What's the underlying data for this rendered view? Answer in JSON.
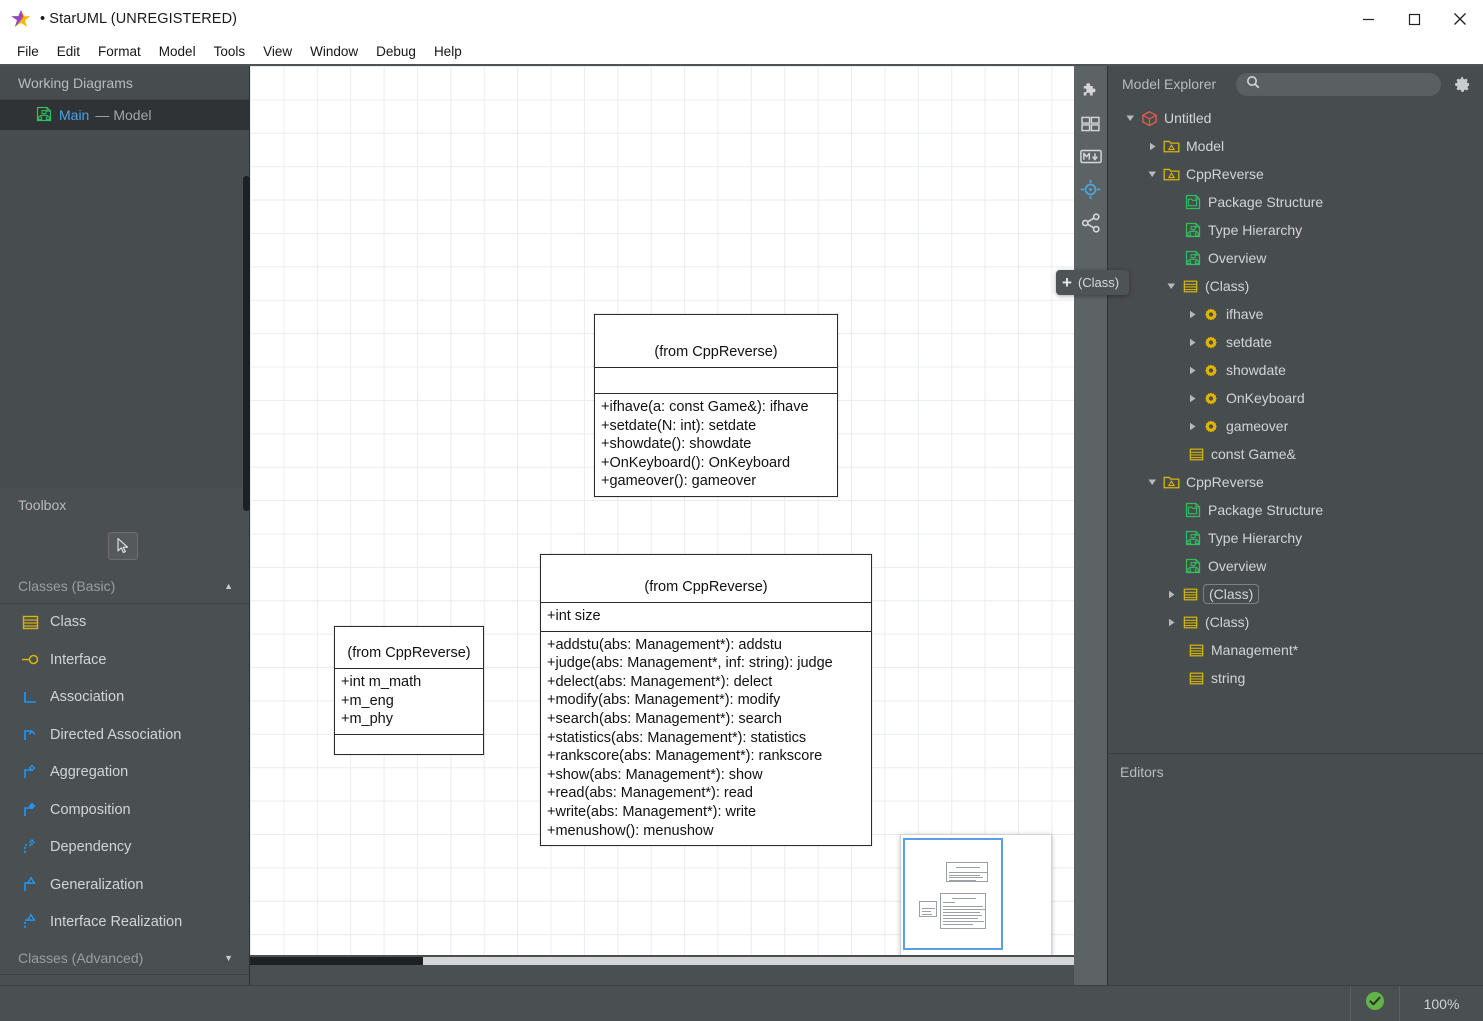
{
  "window": {
    "title": "• StarUML (UNREGISTERED)",
    "app_icon": "star-icon",
    "minimize_label": "—",
    "maximize_label": "▢",
    "close_label": "✕"
  },
  "menubar": {
    "items": [
      {
        "label": "File"
      },
      {
        "label": "Edit"
      },
      {
        "label": "Format"
      },
      {
        "label": "Model"
      },
      {
        "label": "Tools"
      },
      {
        "label": "View"
      },
      {
        "label": "Window"
      },
      {
        "label": "Debug"
      },
      {
        "label": "Help"
      }
    ]
  },
  "sidebar": {
    "working_diagrams": {
      "header": "Working Diagrams",
      "items": [
        {
          "name": "Main",
          "separator": "—",
          "type": "Model",
          "icon": "diagram-icon",
          "selected": true
        }
      ]
    },
    "toolbox": {
      "header": "Toolbox",
      "pointer_icon": "cursor-arrow-icon",
      "groups": [
        {
          "label": "Classes (Basic)",
          "caret": "▲",
          "expanded": true,
          "items": [
            {
              "label": "Class",
              "icon": "class-icon"
            },
            {
              "label": "Interface",
              "icon": "interface-icon"
            },
            {
              "label": "Association",
              "icon": "association-icon"
            },
            {
              "label": "Directed Association",
              "icon": "directed-association-icon"
            },
            {
              "label": "Aggregation",
              "icon": "aggregation-icon"
            },
            {
              "label": "Composition",
              "icon": "composition-icon"
            },
            {
              "label": "Dependency",
              "icon": "dependency-icon"
            },
            {
              "label": "Generalization",
              "icon": "generalization-icon"
            },
            {
              "label": "Interface Realization",
              "icon": "interface-realization-icon"
            }
          ]
        },
        {
          "label": "Classes (Advanced)",
          "caret": "▼",
          "expanded": false,
          "items": []
        }
      ]
    }
  },
  "canvas": {
    "tooltip": {
      "plus": "+",
      "label": "(Class)"
    },
    "rail_icons": [
      {
        "name": "extension-puzzle-icon"
      },
      {
        "name": "panels-grid-icon"
      },
      {
        "name": "markdown-icon"
      },
      {
        "name": "target-crosshair-icon",
        "active": true
      },
      {
        "name": "share-network-icon"
      }
    ],
    "classes": [
      {
        "id": "game-class",
        "from": "(from CppReverse)",
        "attributes": [],
        "operations": [
          "+ifhave(a: const Game&): ifhave",
          "+setdate(N: int): setdate",
          "+showdate(): showdate",
          "+OnKeyboard(): OnKeyboard",
          "+gameover(): gameover"
        ]
      },
      {
        "id": "management-class",
        "from": "(from CppReverse)",
        "attributes": [
          "+int size"
        ],
        "operations": [
          "+addstu(abs: Management*): addstu",
          "+judge(abs: Management*, inf: string): judge",
          "+delect(abs: Management*): delect",
          "+modify(abs: Management*): modify",
          "+search(abs: Management*): search",
          "+statistics(abs: Management*): statistics",
          "+rankscore(abs: Management*): rankscore",
          "+show(abs: Management*): show",
          "+read(abs: Management*): read",
          "+write(abs: Management*): write",
          "+menushow(): menushow"
        ]
      },
      {
        "id": "student-class",
        "from": "(from CppReverse)",
        "attributes": [
          "+int m_math",
          "+m_eng",
          "+m_phy"
        ],
        "operations": []
      }
    ]
  },
  "model_explorer": {
    "title": "Model Explorer",
    "search_placeholder": "",
    "search_value": "",
    "search_icon": "search-icon",
    "gear_icon": "gear-icon",
    "tree": [
      {
        "label": "Untitled",
        "depth": 0,
        "arrow": "down",
        "icon": "project-icon"
      },
      {
        "label": "Model",
        "depth": 1,
        "arrow": "right",
        "icon": "folder-model-icon"
      },
      {
        "label": "CppReverse",
        "depth": 1,
        "arrow": "down",
        "icon": "folder-model-icon"
      },
      {
        "label": "Package Structure",
        "depth": 2,
        "arrow": "none",
        "icon": "package-diagram-icon"
      },
      {
        "label": "Type Hierarchy",
        "depth": 2,
        "arrow": "none",
        "icon": "class-diagram-icon"
      },
      {
        "label": "Overview",
        "depth": 2,
        "arrow": "none",
        "icon": "class-diagram-icon"
      },
      {
        "label": "(Class)",
        "depth": 2,
        "arrow": "down",
        "icon": "class-icon"
      },
      {
        "label": "ifhave",
        "depth": 3,
        "arrow": "right",
        "icon": "operation-icon"
      },
      {
        "label": "setdate",
        "depth": 3,
        "arrow": "right",
        "icon": "operation-icon"
      },
      {
        "label": "showdate",
        "depth": 3,
        "arrow": "right",
        "icon": "operation-icon"
      },
      {
        "label": "OnKeyboard",
        "depth": 3,
        "arrow": "right",
        "icon": "operation-icon"
      },
      {
        "label": "gameover",
        "depth": 3,
        "arrow": "right",
        "icon": "operation-icon"
      },
      {
        "label": "const Game&",
        "depth": 3,
        "arrow": "none",
        "icon": "class-icon"
      },
      {
        "label": "CppReverse",
        "depth": 1,
        "arrow": "down",
        "icon": "folder-model-icon"
      },
      {
        "label": "Package Structure",
        "depth": 2,
        "arrow": "none",
        "icon": "package-diagram-icon"
      },
      {
        "label": "Type Hierarchy",
        "depth": 2,
        "arrow": "none",
        "icon": "class-diagram-icon"
      },
      {
        "label": "Overview",
        "depth": 2,
        "arrow": "none",
        "icon": "class-diagram-icon"
      },
      {
        "label": "(Class)",
        "depth": 2,
        "arrow": "right",
        "icon": "class-icon",
        "selected": true
      },
      {
        "label": "(Class)",
        "depth": 2,
        "arrow": "right",
        "icon": "class-icon"
      },
      {
        "label": "Management*",
        "depth": 2,
        "arrow": "none",
        "icon": "class-icon"
      },
      {
        "label": "string",
        "depth": 2,
        "arrow": "none",
        "icon": "class-icon"
      }
    ]
  },
  "editors": {
    "title": "Editors"
  },
  "statusbar": {
    "check_icon": "check-circle-icon",
    "zoom": "100%"
  },
  "colors": {
    "accent_blue": "#4aa3e8",
    "panel_bg": "#474c4f",
    "toolbox_bg": "#4a4f52",
    "selected_row": "#2f3336",
    "tool_icon_blue": "#2196f3",
    "tool_icon_yellow": "#d6b40e",
    "tree_icon_green": "#23a455",
    "status_green": "#5cb85c",
    "canvas_grid": "#e9ecef"
  }
}
